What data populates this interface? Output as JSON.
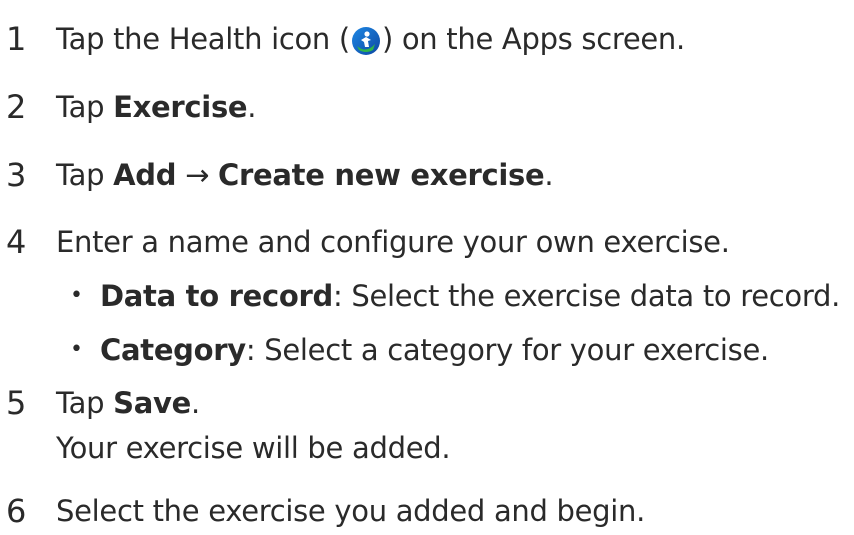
{
  "steps": [
    {
      "num": "1",
      "pre": "Tap the Health icon (",
      "post": ") on the Apps screen.",
      "icon": "health-app-icon"
    },
    {
      "num": "2",
      "pre": "Tap ",
      "bold": "Exercise",
      "post": "."
    },
    {
      "num": "3",
      "pre": "Tap ",
      "bold1": "Add",
      "arrow": " → ",
      "bold2": "Create new exercise",
      "post": "."
    },
    {
      "num": "4",
      "text": "Enter a name and configure your own exercise."
    },
    {
      "num": "5",
      "pre": "Tap ",
      "bold": "Save",
      "post": ".",
      "continuation": "Your exercise will be added."
    },
    {
      "num": "6",
      "text": "Select the exercise you added and begin."
    }
  ],
  "bullets": [
    {
      "bold": "Data to record",
      "text": ": Select the exercise data to record."
    },
    {
      "bold": "Category",
      "text": ": Select a category for your exercise."
    }
  ],
  "colors": {
    "text": "#2a2a2a",
    "icon_blue": "#1a6fd6",
    "icon_green": "#2fb54a"
  }
}
